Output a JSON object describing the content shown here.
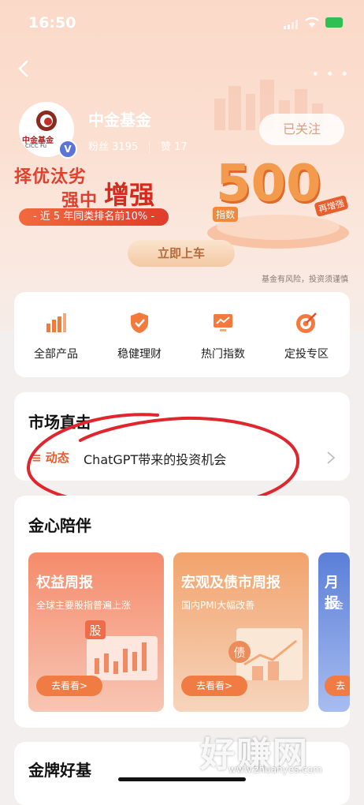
{
  "status": {
    "time": "16:50"
  },
  "profile": {
    "avatar_text": "中金基金",
    "avatar_en": "CICC Fu",
    "verified_badge": "V",
    "name": "中金基金",
    "fans_label": "粉丝",
    "fans": "3195",
    "likes_label": "赞",
    "likes": "17",
    "follow_label": "已关注"
  },
  "banner": {
    "slogan_1": "择优汰劣",
    "slogan_2": "强中",
    "slogan_strong": "增强",
    "rank_text": "- 近 5 年同类排名前10% -",
    "big_number": "500",
    "tag_index": "指数",
    "tag_enhanced": "再增强",
    "cta_label": "立即上车",
    "risk_note": "基金有风险，投资须谨慎"
  },
  "quick_actions": [
    {
      "label": "全部产品",
      "icon": "bar-chart-icon"
    },
    {
      "label": "稳健理财",
      "icon": "shield-icon"
    },
    {
      "label": "热门指数",
      "icon": "monitor-chart-icon"
    },
    {
      "label": "定投专区",
      "icon": "target-icon"
    }
  ],
  "market": {
    "title": "市场直击",
    "tag": "动态",
    "headline": "ChatGPT带来的投资机会"
  },
  "companion": {
    "title": "金心陪伴",
    "cards": [
      {
        "title": "权益周报",
        "subtitle": "全球主要股指普遍上涨",
        "button": "去看看>",
        "art_char": "股"
      },
      {
        "title": "宏观及债市周报",
        "subtitle": "国内PMI大幅改善",
        "button": "去看看>",
        "art_char": "债"
      },
      {
        "title": "月报",
        "subtitle": "基金",
        "button": "去"
      }
    ]
  },
  "gold_fund": {
    "title": "金牌好基"
  },
  "watermark": {
    "brand": "好赚网",
    "url": "www.zhuanyes.com"
  },
  "colors": {
    "accent": "#f05a2b",
    "hero_bg": "#fbd9c8",
    "annotation_red": "#e0262c"
  }
}
